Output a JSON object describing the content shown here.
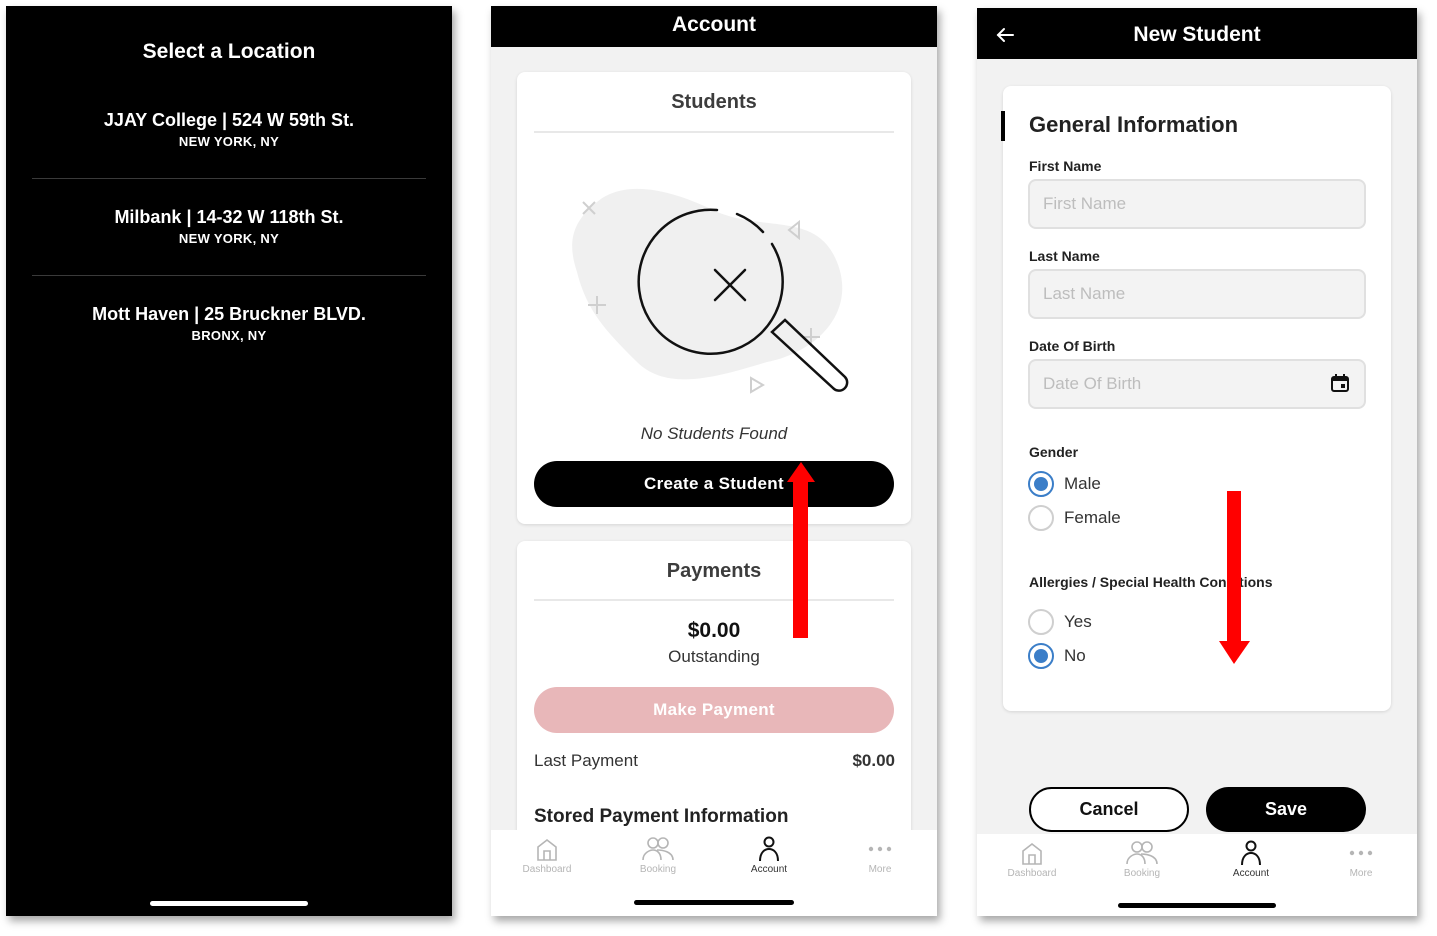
{
  "location_screen": {
    "title": "Select a Location",
    "locations": [
      {
        "name": "JJAY College | 524 W 59th St.",
        "city": "NEW YORK, NY"
      },
      {
        "name": "Milbank | 14-32 W 118th St.",
        "city": "NEW YORK, NY"
      },
      {
        "name": "Mott Haven | 25 Bruckner BLVD.",
        "city": "BRONX, NY"
      }
    ]
  },
  "account_screen": {
    "title": "Account",
    "students": {
      "title": "Students",
      "empty_text": "No Students Found",
      "create_button": "Create a Student"
    },
    "payments": {
      "title": "Payments",
      "amount": "$0.00",
      "amount_label": "Outstanding",
      "make_payment_button": "Make Payment",
      "last_payment_label": "Last Payment",
      "last_payment_value": "$0.00",
      "stored_label": "Stored Payment Information"
    }
  },
  "new_student_screen": {
    "title": "New Student",
    "section_title": "General Information",
    "first_name": {
      "label": "First Name",
      "placeholder": "First Name",
      "value": ""
    },
    "last_name": {
      "label": "Last Name",
      "placeholder": "Last Name",
      "value": ""
    },
    "dob": {
      "label": "Date Of Birth",
      "placeholder": "Date Of Birth",
      "value": ""
    },
    "gender": {
      "label": "Gender",
      "options": [
        "Male",
        "Female"
      ],
      "selected": "Male"
    },
    "allergies": {
      "label": "Allergies / Special Health Conditions",
      "options": [
        "Yes",
        "No"
      ],
      "selected": "No"
    },
    "cancel_button": "Cancel",
    "save_button": "Save"
  },
  "tabbar": {
    "items": [
      {
        "label": "Dashboard",
        "icon": "home-icon"
      },
      {
        "label": "Booking",
        "icon": "people-icon"
      },
      {
        "label": "Account",
        "icon": "person-icon"
      },
      {
        "label": "More",
        "icon": "more-icon"
      }
    ],
    "active": "Account"
  },
  "colors": {
    "header_bg": "#000000",
    "screen_bg": "#f2f2f2",
    "radio_selected": "#3b7ec8",
    "disabled_pink": "#e8b7b9",
    "annotation_arrow": "#ff0000"
  }
}
